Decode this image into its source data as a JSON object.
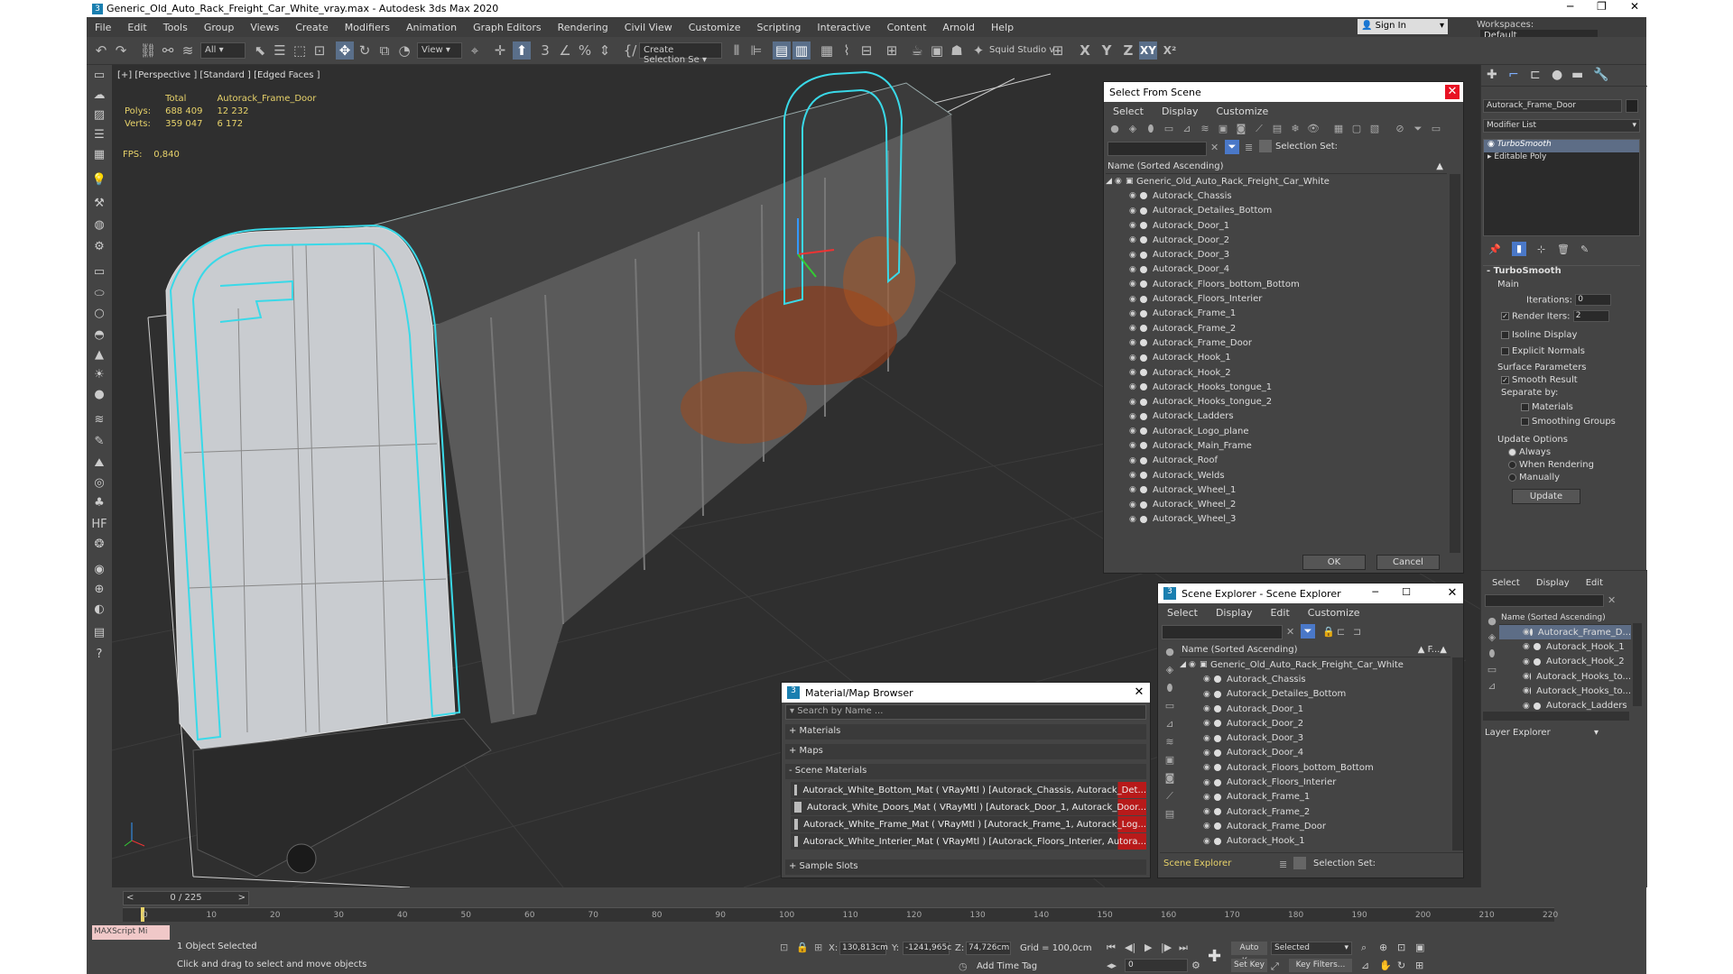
{
  "window": {
    "title": "Generic_Old_Auto_Rack_Freight_Car_White_vray.max - Autodesk 3ds Max 2020",
    "app_icon": "3"
  },
  "menu": [
    "File",
    "Edit",
    "Tools",
    "Group",
    "Views",
    "Create",
    "Modifiers",
    "Animation",
    "Graph Editors",
    "Rendering",
    "Civil View",
    "Customize",
    "Scripting",
    "Interactive",
    "Content",
    "Arnold",
    "Help"
  ],
  "signin": "Sign In",
  "workspace": {
    "label": "Workspaces:",
    "value": "Default"
  },
  "toolbar": {
    "filter": "All",
    "view": "View",
    "selection_set": "Create Selection Se",
    "squid": "Squid Studio v"
  },
  "viewport": {
    "label": "[+] [Perspective ] [Standard ] [Edged Faces ]",
    "stats": {
      "h_total": "Total",
      "h_obj": "Autorack_Frame_Door",
      "polys_label": "Polys:",
      "polys_total": "688 409",
      "polys_obj": "12 232",
      "verts_label": "Verts:",
      "verts_total": "359 047",
      "verts_obj": "6 172",
      "fps_label": "FPS:",
      "fps": "0,840"
    }
  },
  "select_from_scene": {
    "title": "Select From Scene",
    "menu": [
      "Select",
      "Display",
      "Customize"
    ],
    "selection_set_label": "Selection Set:",
    "col_header": "Name (Sorted Ascending)",
    "root": "Generic_Old_Auto_Rack_Freight_Car_White",
    "items": [
      "Autorack_Chassis",
      "Autorack_Detailes_Bottom",
      "Autorack_Door_1",
      "Autorack_Door_2",
      "Autorack_Door_3",
      "Autorack_Door_4",
      "Autorack_Floors_bottom_Bottom",
      "Autorack_Floors_Interier",
      "Autorack_Frame_1",
      "Autorack_Frame_2",
      "Autorack_Frame_Door",
      "Autorack_Hook_1",
      "Autorack_Hook_2",
      "Autorack_Hooks_tongue_1",
      "Autorack_Hooks_tongue_2",
      "Autorack_Ladders",
      "Autorack_Logo_plane",
      "Autorack_Main_Frame",
      "Autorack_Roof",
      "Autorack_Welds",
      "Autorack_Wheel_1",
      "Autorack_Wheel_2",
      "Autorack_Wheel_3"
    ],
    "ok": "OK",
    "cancel": "Cancel"
  },
  "scene_explorer": {
    "title": "Scene Explorer - Scene Explorer",
    "menu": [
      "Select",
      "Display",
      "Edit",
      "Customize"
    ],
    "col_header": "Name (Sorted Ascending)",
    "col_frozen": "▲ F...▲",
    "root": "Generic_Old_Auto_Rack_Freight_Car_White",
    "items": [
      "Autorack_Chassis",
      "Autorack_Detailes_Bottom",
      "Autorack_Door_1",
      "Autorack_Door_2",
      "Autorack_Door_3",
      "Autorack_Door_4",
      "Autorack_Floors_bottom_Bottom",
      "Autorack_Floors_Interier",
      "Autorack_Frame_1",
      "Autorack_Frame_2",
      "Autorack_Frame_Door",
      "Autorack_Hook_1"
    ],
    "footer": "Scene Explorer",
    "selection_set_label": "Selection Set:"
  },
  "material_browser": {
    "title": "Material/Map Browser",
    "search_placeholder": "Search by Name ...",
    "sections": [
      "+ Materials",
      "+ Maps",
      "- Scene Materials"
    ],
    "materials": [
      "Autorack_White_Bottom_Mat  ( VRayMtl )  [Autorack_Chassis, Autorack_Det...",
      "Autorack_White_Doors_Mat  ( VRayMtl )  [Autorack_Door_1, Autorack_Door...",
      "Autorack_White_Frame_Mat  ( VRayMtl )  [Autorack_Frame_1, Autorack_Log...",
      "Autorack_White_Interier_Mat  ( VRayMtl )  [Autorack_Floors_Interier, Autora..."
    ],
    "sample_slots": "+ Sample Slots"
  },
  "command_panel": {
    "object_name": "Autorack_Frame_Door",
    "modifier_list": "Modifier List",
    "stack": [
      "TurboSmooth",
      "Editable Poly"
    ],
    "rollout": "TurboSmooth",
    "main": "Main",
    "iterations_label": "Iterations:",
    "iterations": "0",
    "render_iters_label": "Render Iters:",
    "render_iters": "2",
    "isoline": "Isoline Display",
    "explicit": "Explicit Normals",
    "surface_params": "Surface Parameters",
    "smooth_result": "Smooth Result",
    "separate_by": "Separate by:",
    "materials": "Materials",
    "smoothing_groups": "Smoothing Groups",
    "update_options": "Update Options",
    "always": "Always",
    "when_rendering": "When Rendering",
    "manually": "Manually",
    "update_btn": "Update"
  },
  "layer_explorer": {
    "menu": [
      "Select",
      "Display",
      "Edit"
    ],
    "col_header": "Name (Sorted Ascending)",
    "items": [
      "Autorack_Frame_D...",
      "Autorack_Hook_1",
      "Autorack_Hook_2",
      "Autorack_Hooks_to...",
      "Autorack_Hooks_to...",
      "Autorack_Ladders"
    ],
    "footer": "Layer Explorer"
  },
  "timeline": {
    "frame": "0 / 225",
    "ticks": [
      "0",
      "10",
      "20",
      "30",
      "40",
      "50",
      "60",
      "70",
      "80",
      "90",
      "100",
      "110",
      "120",
      "130",
      "140",
      "150",
      "160",
      "170",
      "180",
      "190",
      "200",
      "210",
      "220"
    ]
  },
  "status": {
    "maxscript": "MAXScript Mi",
    "selected": "1 Object Selected",
    "prompt": "Click and drag to select and move objects",
    "x_label": "X:",
    "x": "130,813cm",
    "y_label": "Y:",
    "y": "-1241,965c",
    "z_label": "Z:",
    "z": "74,726cm",
    "grid": "Grid = 100,0cm",
    "add_time_tag": "Add Time Tag",
    "auto_key": "Auto Key",
    "set_key": "Set Key",
    "selected_dd": "Selected",
    "key_filters": "Key Filters...",
    "frame_field": "0"
  }
}
